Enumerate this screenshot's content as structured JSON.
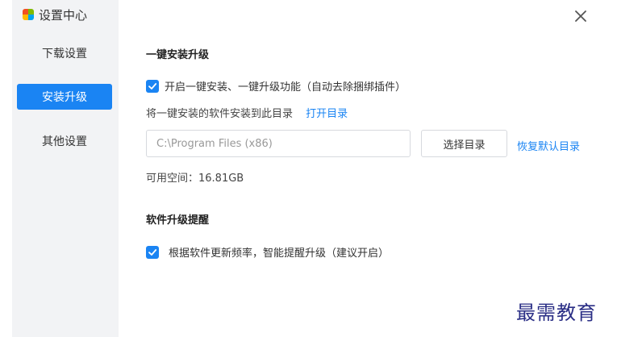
{
  "app": {
    "title": "设置中心"
  },
  "sidebar": {
    "items": [
      {
        "label": "下载设置",
        "active": false
      },
      {
        "label": "安装升级",
        "active": true
      },
      {
        "label": "其他设置",
        "active": false
      }
    ]
  },
  "install_section": {
    "title": "一键安装升级",
    "checkbox_label": "开启一键安装、一键升级功能（自动去除捆绑插件）",
    "checkbox_checked": true,
    "dir_text": "将一键安装的软件安装到此目录",
    "open_dir_link": "打开目录",
    "path_value": "C:\\Program Files (x86)",
    "choose_dir_button": "选择目录",
    "restore_default_link": "恢复默认目录",
    "free_space": "可用空间：16.81GB"
  },
  "upgrade_section": {
    "title": "软件升级提醒",
    "checkbox_label": "根据软件更新频率，智能提醒升级（建议开启）",
    "checkbox_checked": true
  },
  "watermark": "最需教育",
  "colors": {
    "accent": "#1a84f3",
    "sidebar_bg": "#f2f3f5",
    "watermark": "#2b2f86"
  },
  "icons": {
    "close": "close-icon",
    "check": "check-icon",
    "logo": "app-logo-icon"
  }
}
